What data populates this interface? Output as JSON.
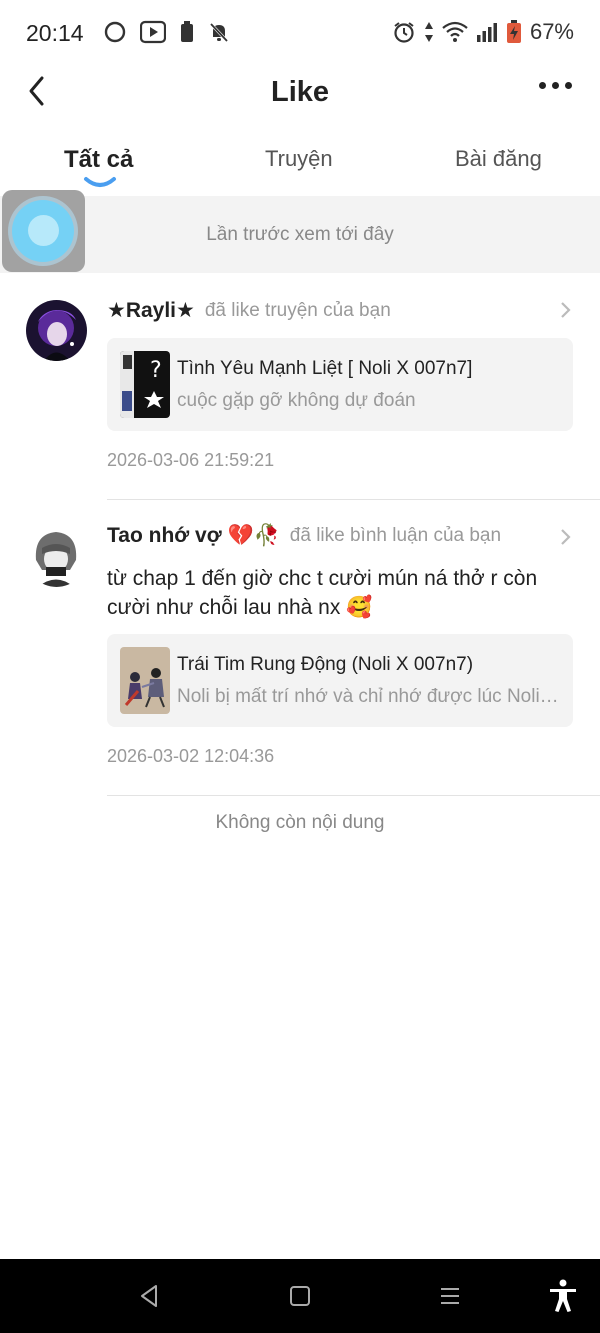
{
  "status_bar": {
    "time": "20:14",
    "battery_percent": "67%",
    "icons": [
      "circle-icon",
      "youtube-icon",
      "battery-small-icon",
      "bell-off-icon",
      "alarm-icon",
      "data-arrows-icon",
      "wifi-icon",
      "signal-icon",
      "battery-icon"
    ]
  },
  "header": {
    "title": "Like",
    "back_icon": "chevron-left-icon",
    "more_icon": "more-dots-icon"
  },
  "tabs": [
    {
      "label": "Tất cả",
      "active": true
    },
    {
      "label": "Truyện",
      "active": false
    },
    {
      "label": "Bài đăng",
      "active": false
    }
  ],
  "recent_marker": "Lần trước xem tới đây",
  "items": [
    {
      "user": "★Rayli★",
      "action": "đã like truyện của bạn",
      "card_title": "Tình Yêu Mạnh Liệt [ Noli X 007n7]",
      "card_subtitle": "cuộc gặp gỡ không dự đoán",
      "timestamp": "2026-03-06 21:59:21"
    },
    {
      "user": "Tao nhớ vợ 💔🥀",
      "action": "đã like bình luận của bạn",
      "comment": "từ chap 1 đến giờ chc t cười mún ná thở r còn cười như chỗi lau nhà nx 🥰",
      "card_title": "Trái Tim Rung Động (Noli X 007n7)",
      "card_subtitle": "Noli bị mất trí nhớ và chỉ nhớ được lúc Noli còn nhỏ",
      "timestamp": "2026-03-02 12:04:36"
    }
  ],
  "end_text": "Không còn nội dung",
  "nav_bar": {
    "icons": [
      "back-triangle-icon",
      "home-square-icon",
      "recents-lines-icon",
      "accessibility-icon"
    ]
  },
  "colors": {
    "accent": "#4a9ef0",
    "float_button": "#6fd0f6",
    "muted_text": "#999999",
    "card_bg": "#f3f3f3"
  }
}
